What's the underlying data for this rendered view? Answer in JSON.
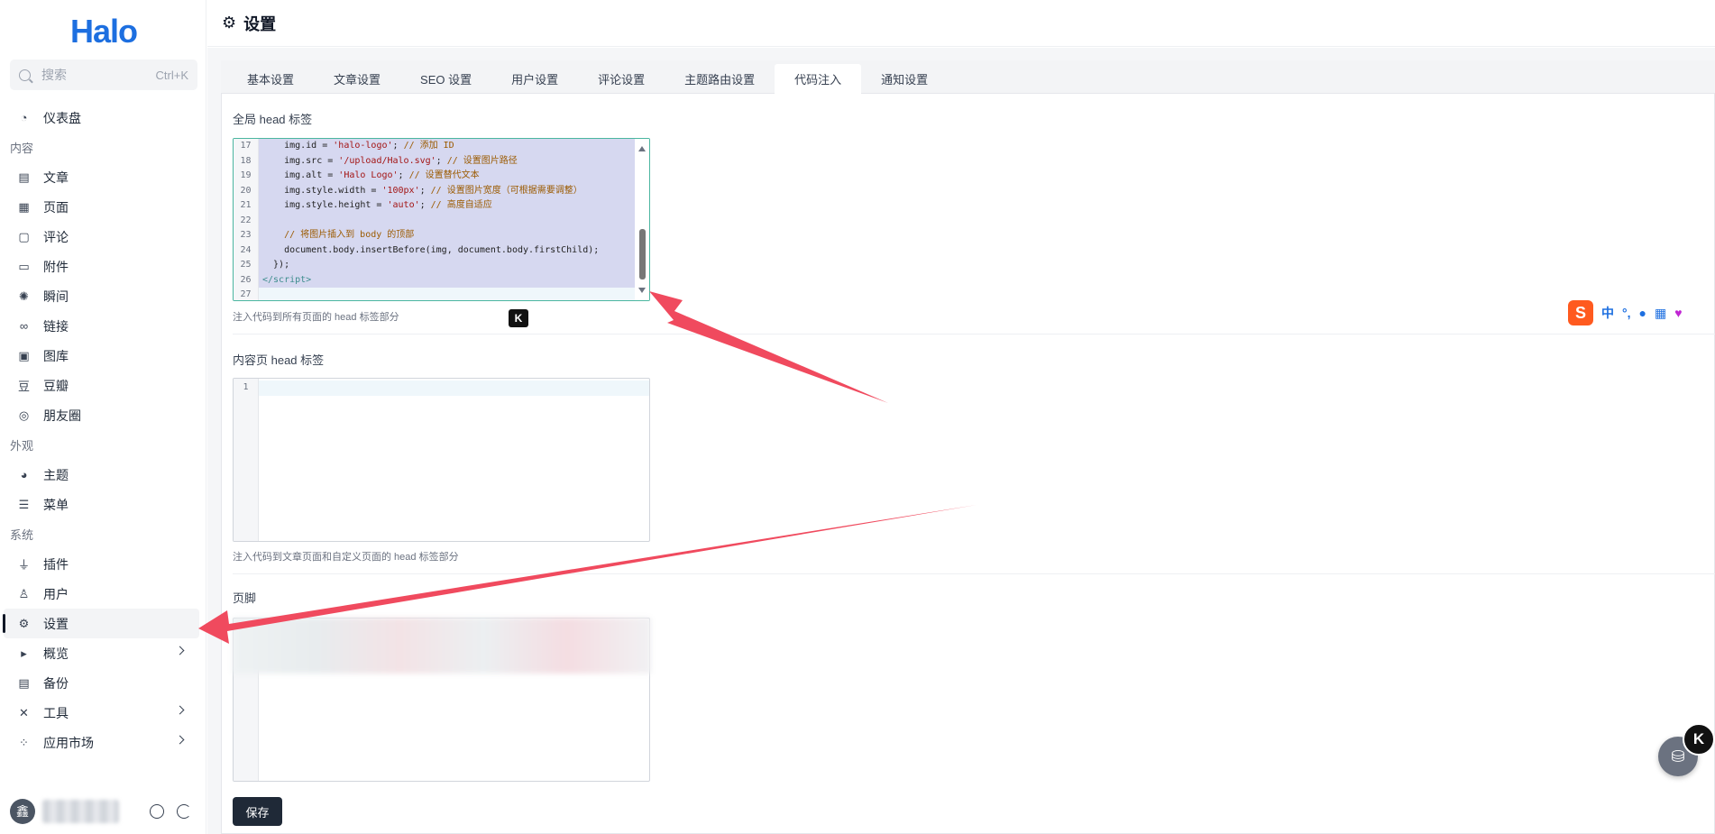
{
  "sidebar": {
    "logo": "Halo",
    "search_placeholder": "搜索",
    "search_shortcut": "Ctrl+K",
    "dashboard": "仪表盘",
    "group_content": "内容",
    "content_items": [
      "文章",
      "页面",
      "评论",
      "附件",
      "瞬间",
      "链接",
      "图库",
      "豆瓣",
      "朋友圈"
    ],
    "group_appearance": "外观",
    "appearance_items": [
      "主题",
      "菜单"
    ],
    "group_system": "系统",
    "system_items": [
      "插件",
      "用户",
      "设置",
      "概览",
      "备份",
      "工具",
      "应用市场"
    ],
    "avatar_char": "鑫"
  },
  "header": {
    "title": "设置"
  },
  "tabs": [
    "基本设置",
    "文章设置",
    "SEO 设置",
    "用户设置",
    "评论设置",
    "主题路由设置",
    "代码注入",
    "通知设置"
  ],
  "active_tab": "代码注入",
  "global_head": {
    "label": "全局 head 标签",
    "help": "注入代码到所有页面的 head 标签部分",
    "line_numbers": [
      "17",
      "18",
      "19",
      "20",
      "21",
      "22",
      "23",
      "24",
      "25",
      "26",
      "27"
    ]
  },
  "content_head": {
    "label": "内容页 head 标签",
    "help": "注入代码到文章页面和自定义页面的 head 标签部分",
    "line_numbers": [
      "1"
    ]
  },
  "footer": {
    "label": "页脚"
  },
  "save_button": "保存",
  "k_badge": "K",
  "ime": {
    "s": "S",
    "zh": "中"
  },
  "colors": {
    "accent": "#1d6fe0",
    "arrow": "#f04a5e",
    "save_bg": "#1f2937",
    "focus_border": "#4bb6a0"
  }
}
